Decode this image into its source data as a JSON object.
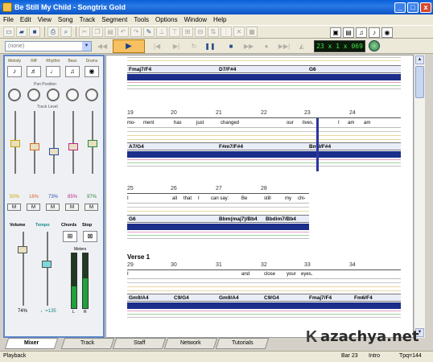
{
  "window": {
    "title": "Be Still My Child - Songtrix Gold",
    "min": "_",
    "max": "□",
    "close": "x"
  },
  "menu": [
    "File",
    "Edit",
    "View",
    "Song",
    "Track",
    "Segment",
    "Tools",
    "Options",
    "Window",
    "Help"
  ],
  "toolbar2": {
    "dropdown_value": "(none)",
    "lcd": "23 x 1 x 069"
  },
  "mixer": {
    "channels": [
      {
        "name": "Melody",
        "percent": "50%",
        "color": "#c9a400"
      },
      {
        "name": "Riff",
        "percent": "16%",
        "color": "#d86a2a"
      },
      {
        "name": "Rhythm",
        "percent": "73%",
        "color": "#2a4fb0"
      },
      {
        "name": "Bass",
        "percent": "85%",
        "color": "#c02a8a"
      },
      {
        "name": "Drums",
        "percent": "97%",
        "color": "#2a8a3a"
      }
    ],
    "pan_label": "Pan Position",
    "volume_label": "Track Level",
    "mute": "M",
    "bottom": {
      "volume": "Volume",
      "tempo": "Tempo",
      "chords": "Chords",
      "stop": "Stop",
      "meters": "Meters",
      "volume_val": "74%",
      "tempo_val": "♩=135",
      "left": "L",
      "right": "R"
    }
  },
  "score": {
    "systems": [
      {
        "chords": [
          "Fmaj7/F4",
          "D7/F#4",
          "G6"
        ]
      },
      {
        "measures": [
          "19",
          "20",
          "21",
          "22",
          "23",
          "24"
        ],
        "lyrics": [
          "mo-",
          "ment",
          "has",
          "just",
          "changed",
          "our",
          "lives,",
          "I",
          "am",
          "am"
        ],
        "chords": [
          "A7/G4",
          "F#m7/F#4",
          "Bm9/F#4"
        ]
      },
      {
        "measures": [
          "25",
          "26",
          "27",
          "28"
        ],
        "lyrics": [
          "I",
          "all",
          "that",
          "I",
          "can say:",
          "Be",
          "still",
          "my",
          "chi-"
        ],
        "chords": [
          "G6",
          "Bbm(maj7)/Bb4",
          "Bbdim7/Bb4"
        ]
      },
      {
        "section": "Verse 1",
        "measures": [
          "29",
          "30",
          "31",
          "32",
          "33",
          "34"
        ],
        "lyrics": [
          "I",
          "and",
          "close",
          "your",
          "eyes,"
        ],
        "chords": [
          "Gm9/A4",
          "C9/G4",
          "Gm9/A4",
          "C9/G4",
          "Fmaj7/F4",
          "Fm6/F4"
        ]
      }
    ]
  },
  "tabs": [
    "Mixer",
    "Track",
    "Staff",
    "Network",
    "Tutorials"
  ],
  "status": {
    "left": "Playback",
    "bar": "Bar 23",
    "segment": "Intro",
    "tpq": "Tpq=144"
  },
  "watermark": "azachya.net"
}
